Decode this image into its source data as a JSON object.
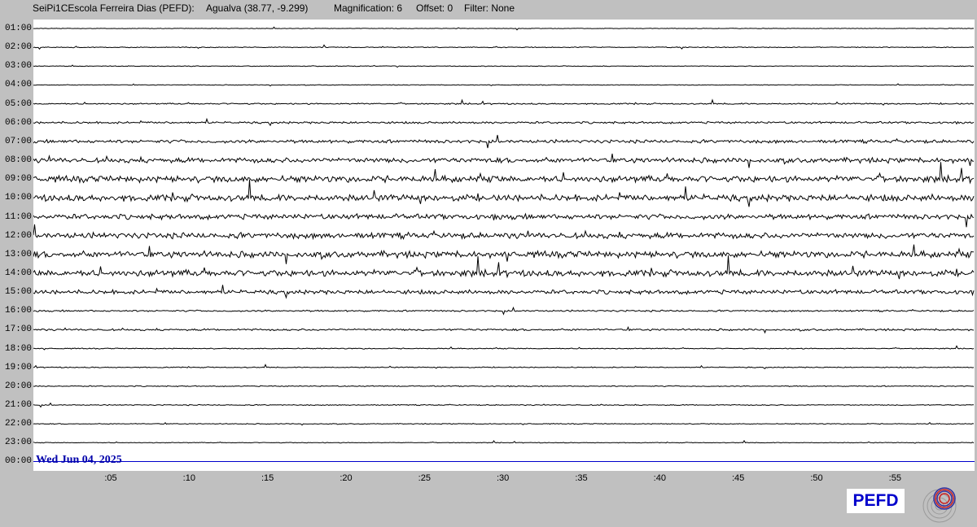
{
  "header": {
    "station": "SeiPi1CEscola Ferreira Dias (PEFD):",
    "location": "Agualva (38.77, -9.299)",
    "magnification": "Magnification: 6",
    "offset": "Offset: 0",
    "filter": "Filter: None"
  },
  "hours": [
    "01:00",
    "02:00",
    "03:00",
    "04:00",
    "05:00",
    "06:00",
    "07:00",
    "08:00",
    "09:00",
    "10:00",
    "11:00",
    "12:00",
    "13:00",
    "14:00",
    "15:00",
    "16:00",
    "17:00",
    "18:00",
    "19:00",
    "20:00",
    "21:00",
    "22:00",
    "23:00",
    "00:00"
  ],
  "hour_activity": [
    0.4,
    0.6,
    0.5,
    0.5,
    1.0,
    1.5,
    2.4,
    3.6,
    4.6,
    4.8,
    3.8,
    4.2,
    4.6,
    4.6,
    3.0,
    1.2,
    1.4,
    0.7,
    0.7,
    0.7,
    0.7,
    0.6,
    0.5,
    0.0
  ],
  "minutes": [
    ":05",
    ":10",
    ":15",
    ":20",
    ":25",
    ":30",
    ":35",
    ":40",
    ":45",
    ":50",
    ":55"
  ],
  "date_label": "Wed Jun 04, 2025",
  "logo_text": "PEFD",
  "colors": {
    "background": "#c0c0c0",
    "plot": "#ffffff",
    "trace": "#000000",
    "current_line": "#0000cc",
    "date_text": "#0000aa",
    "logo_text": "#0000cc"
  },
  "icons": {
    "seal": "concentric-rings-logo-icon"
  }
}
